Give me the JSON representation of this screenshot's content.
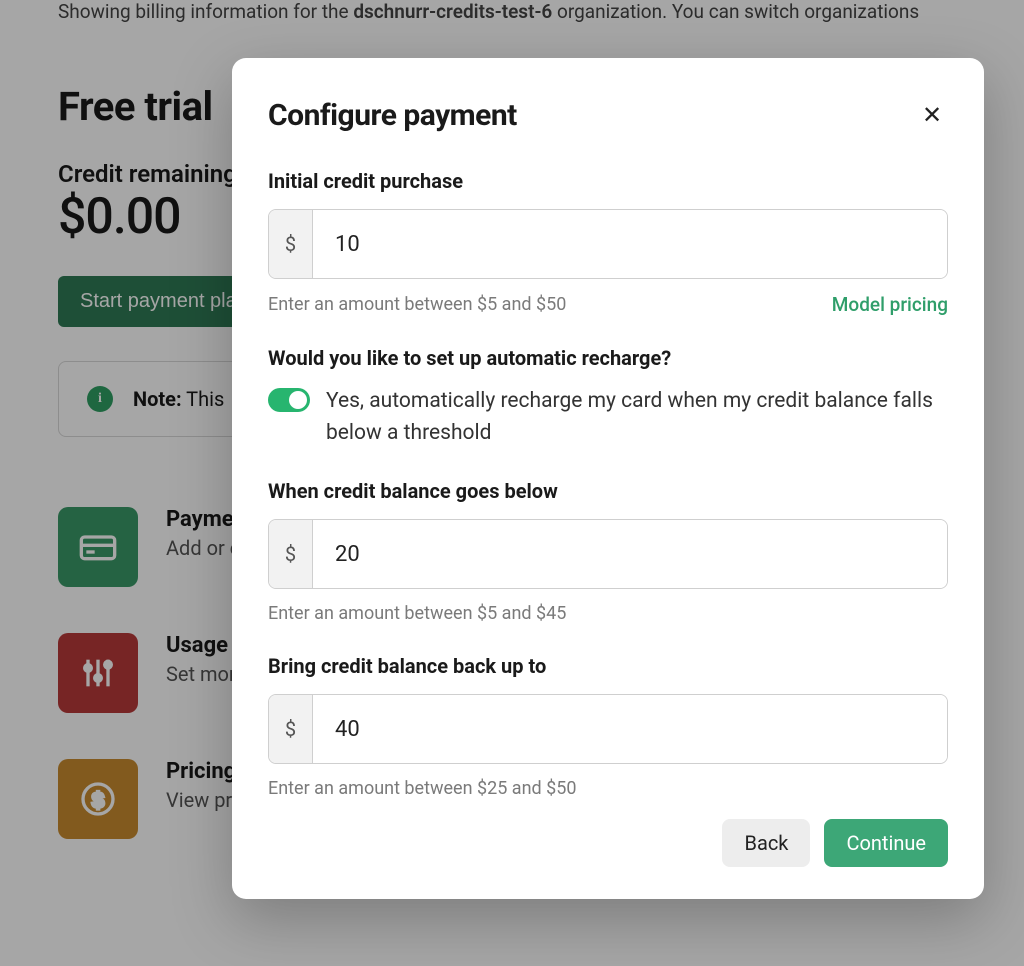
{
  "bg": {
    "intro_prefix": "Showing billing information for the ",
    "intro_org": "dschnurr-credits-test-6",
    "intro_suffix": " organization. You can switch organizations",
    "heading": "Free trial",
    "credit_label": "Credit remaining",
    "credit_amount": "$0.00",
    "start_btn": "Start payment plan",
    "note_label": "Note:",
    "note_text": " This",
    "tiles": {
      "payments": {
        "title": "Payments",
        "desc": "Add or change payment method, view invoices"
      },
      "usage": {
        "title": "Usage limits",
        "desc": "Set monthly spend limits and configure notification"
      },
      "pricing": {
        "title": "Pricing",
        "desc": "View pricing"
      }
    }
  },
  "modal": {
    "title": "Configure payment",
    "initial": {
      "label": "Initial credit purchase",
      "value": "10",
      "prefix": "$",
      "hint": "Enter an amount between $5 and $50",
      "pricing_link": "Model pricing"
    },
    "auto": {
      "question": "Would you like to set up automatic recharge?",
      "toggle_text": "Yes, automatically recharge my card when my credit balance falls below a threshold"
    },
    "below": {
      "label": "When credit balance goes below",
      "value": "20",
      "prefix": "$",
      "hint": "Enter an amount between $5 and $45"
    },
    "upto": {
      "label": "Bring credit balance back up to",
      "value": "40",
      "prefix": "$",
      "hint": "Enter an amount between $25 and $50"
    },
    "back_btn": "Back",
    "continue_btn": "Continue"
  }
}
